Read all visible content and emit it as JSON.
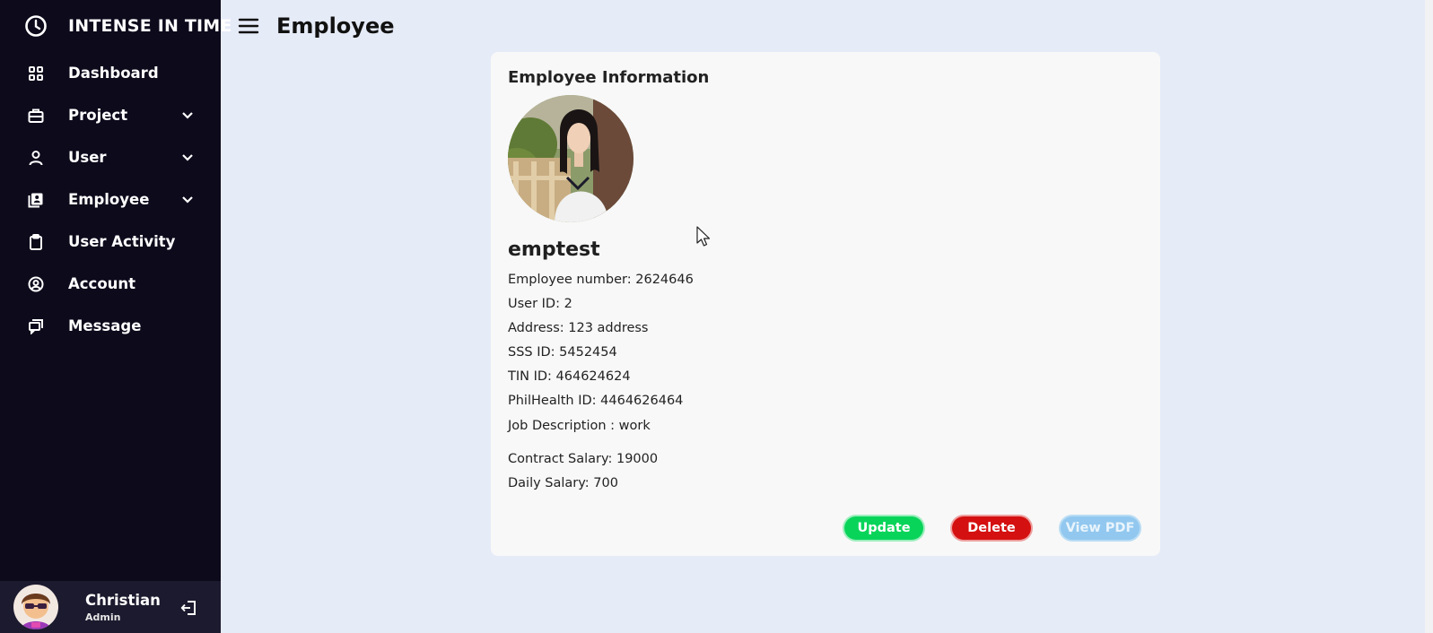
{
  "brand": {
    "name": "INTENSE IN TIME",
    "icon": "clock-icon"
  },
  "sidebar": {
    "items": [
      {
        "label": "Dashboard",
        "icon": "grid-icon",
        "expandable": false
      },
      {
        "label": "Project",
        "icon": "briefcase-icon",
        "expandable": true
      },
      {
        "label": "User",
        "icon": "person-icon",
        "expandable": true
      },
      {
        "label": "Employee",
        "icon": "contact-book-icon",
        "expandable": true
      },
      {
        "label": "User Activity",
        "icon": "clipboard-icon",
        "expandable": false
      },
      {
        "label": "Account",
        "icon": "user-circle-icon",
        "expandable": false
      },
      {
        "label": "Message",
        "icon": "chat-icon",
        "expandable": false
      }
    ]
  },
  "user": {
    "name": "Christian",
    "role": "Admin"
  },
  "header": {
    "title": "Employee"
  },
  "employee": {
    "card_title": "Employee Information",
    "name": "emptest",
    "fields": [
      "Employee number: 2624646",
      "User ID: 2",
      "Address: 123 address",
      "SSS ID: 5452454",
      "TIN ID: 464624624",
      "PhilHealth ID: 4464626464",
      "Job Description : work",
      "Contract Salary: 19000",
      "Daily Salary: 700"
    ]
  },
  "actions": {
    "update": "Update",
    "delete": "Delete",
    "view_pdf": "View PDF"
  },
  "colors": {
    "sidebar_bg": "#0c0a1b",
    "page_bg": "#e6ebf8",
    "update": "#09d45a",
    "delete": "#d41010",
    "view_pdf": "#92c8ef"
  }
}
